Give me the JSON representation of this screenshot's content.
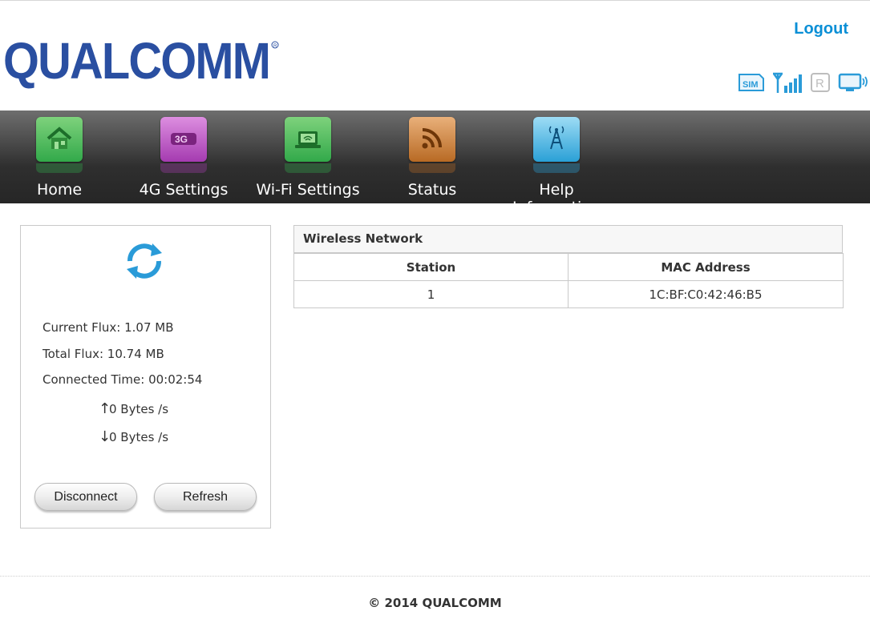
{
  "header": {
    "brand": "QUALCOMM",
    "logout_label": "Logout",
    "status_icons": [
      "sim-icon",
      "signal-bars-icon",
      "roaming-r-icon",
      "monitor-wifi-icon"
    ],
    "accent_color": "#0a8fd6"
  },
  "nav": {
    "items": [
      {
        "label": "Home",
        "icon": "home-icon",
        "color": "#3fb34f"
      },
      {
        "label": "4G Settings",
        "icon": "3g-icon",
        "color": "#b344b8"
      },
      {
        "label": "Wi-Fi Settings",
        "icon": "laptop-wifi-icon",
        "color": "#3fb34f"
      },
      {
        "label": "Status",
        "icon": "rss-icon",
        "color": "#c77a2e"
      },
      {
        "label": "Help Information",
        "icon": "antenna-tower-icon",
        "color": "#3aa9d9"
      }
    ]
  },
  "panel": {
    "current_flux": "Current Flux: 1.07 MB",
    "total_flux": "Total Flux: 10.74 MB",
    "connected_time": "Connected Time: 00:02:54",
    "upload_rate": "0 Bytes /s",
    "download_rate": "0 Bytes /s",
    "disconnect_label": "Disconnect",
    "refresh_label": "Refresh"
  },
  "wireless_network": {
    "title": "Wireless Network",
    "columns": [
      "Station",
      "MAC Address"
    ],
    "rows": [
      [
        "1",
        "1C:BF:C0:42:46:B5"
      ]
    ]
  },
  "footer": {
    "copyright": "© 2014 QUALCOMM"
  }
}
